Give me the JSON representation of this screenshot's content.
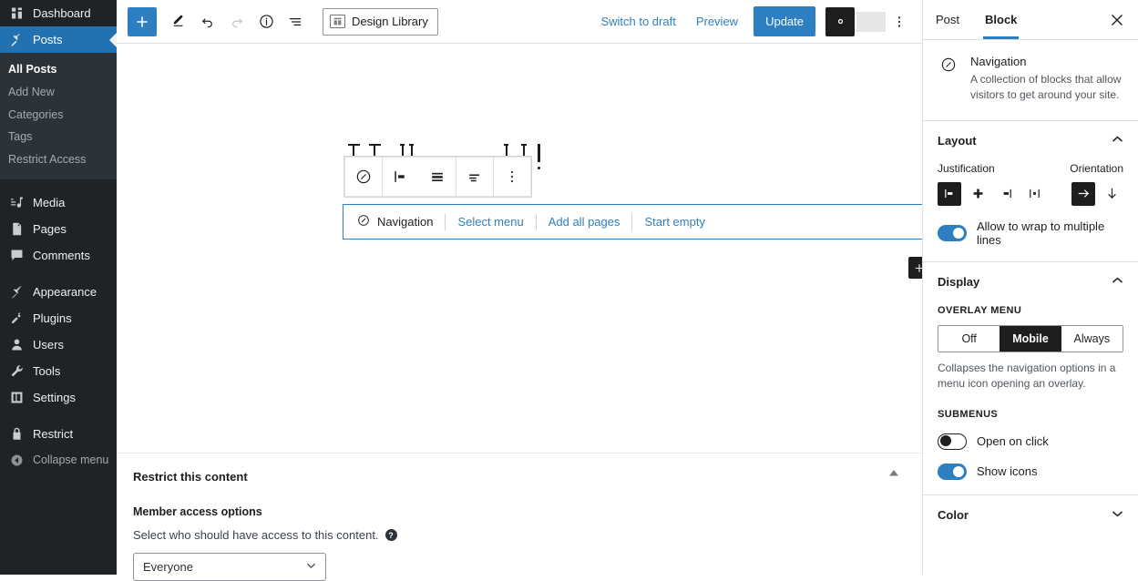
{
  "admin_sidebar": {
    "items": [
      {
        "label": "Dashboard",
        "icon": "dashboard-icon",
        "current": false
      },
      {
        "label": "Posts",
        "icon": "pin-icon",
        "current": true
      },
      {
        "label": "Media",
        "icon": "media-icon",
        "current": false
      },
      {
        "label": "Pages",
        "icon": "pages-icon",
        "current": false
      },
      {
        "label": "Comments",
        "icon": "comments-icon",
        "current": false
      },
      {
        "label": "Appearance",
        "icon": "appearance-icon",
        "current": false
      },
      {
        "label": "Plugins",
        "icon": "plugins-icon",
        "current": false
      },
      {
        "label": "Users",
        "icon": "users-icon",
        "current": false
      },
      {
        "label": "Tools",
        "icon": "tools-icon",
        "current": false
      },
      {
        "label": "Settings",
        "icon": "settings-icon",
        "current": false
      },
      {
        "label": "Restrict",
        "icon": "lock-icon",
        "current": false
      },
      {
        "label": "Collapse menu",
        "icon": "collapse-icon",
        "current": false
      }
    ],
    "posts_submenu": [
      {
        "label": "All Posts",
        "current": true
      },
      {
        "label": "Add New",
        "current": false
      },
      {
        "label": "Categories",
        "current": false
      },
      {
        "label": "Tags",
        "current": false
      },
      {
        "label": "Restrict Access",
        "current": false
      }
    ],
    "highlight_color": "#2271b1",
    "background_color": "#1d2327"
  },
  "header": {
    "add_block_label": "+",
    "tools_label": "Edit",
    "undo_label": "Undo",
    "redo_label": "Redo",
    "details_label": "Details",
    "list_view_label": "List View",
    "design_library_label": "Design Library",
    "switch_to_draft_label": "Switch to draft",
    "preview_label": "Preview",
    "update_label": "Update",
    "settings_label": "Settings",
    "options_label": "Options",
    "accent_color": "#2e7fc1"
  },
  "block_toolbar": {
    "block_type_label": "Navigation",
    "justify_label": "Justify items left",
    "align_label": "Align",
    "text_align_label": "Change text alignment",
    "options_label": "Options"
  },
  "canvas": {
    "navigation_block": {
      "label": "Navigation",
      "links": [
        "Select menu",
        "Add all pages",
        "Start empty"
      ]
    },
    "appender_label": "+"
  },
  "restrict_panel": {
    "title": "Restrict this content",
    "subtitle": "Member access options",
    "description": "Select who should have access to this content.",
    "help_label": "?",
    "select_value": "Everyone",
    "collapse_label": "▲"
  },
  "settings_sidebar": {
    "tabs": [
      {
        "label": "Post",
        "active": false
      },
      {
        "label": "Block",
        "active": true
      }
    ],
    "close_label": "✕",
    "block_card": {
      "title": "Navigation",
      "description": "A collection of blocks that allow visitors to get around your site."
    },
    "layout": {
      "title": "Layout",
      "chevron": "⌃",
      "justification_label": "Justification",
      "orientation_label": "Orientation",
      "justification_options": [
        {
          "name": "justify-left-icon",
          "selected": true
        },
        {
          "name": "justify-center-icon",
          "selected": false
        },
        {
          "name": "justify-right-icon",
          "selected": false
        },
        {
          "name": "justify-space-between-icon",
          "selected": false
        }
      ],
      "orientation_options": [
        {
          "name": "orientation-horizontal-icon",
          "selected": true
        },
        {
          "name": "orientation-vertical-icon",
          "selected": false
        }
      ],
      "wrap_label": "Allow to wrap to multiple lines",
      "wrap_enabled": true
    },
    "display": {
      "title": "Display",
      "chevron": "⌃",
      "overlay_menu_label": "OVERLAY MENU",
      "overlay_options": [
        {
          "label": "Off",
          "selected": false
        },
        {
          "label": "Mobile",
          "selected": true
        },
        {
          "label": "Always",
          "selected": false
        }
      ],
      "overlay_help": "Collapses the navigation options in a menu icon opening an overlay.",
      "submenus_label": "SUBMENUS",
      "open_on_click_label": "Open on click",
      "open_on_click_enabled": false,
      "show_icons_label": "Show icons",
      "show_icons_enabled": true
    },
    "color": {
      "title": "Color",
      "chevron": "⌄"
    }
  }
}
